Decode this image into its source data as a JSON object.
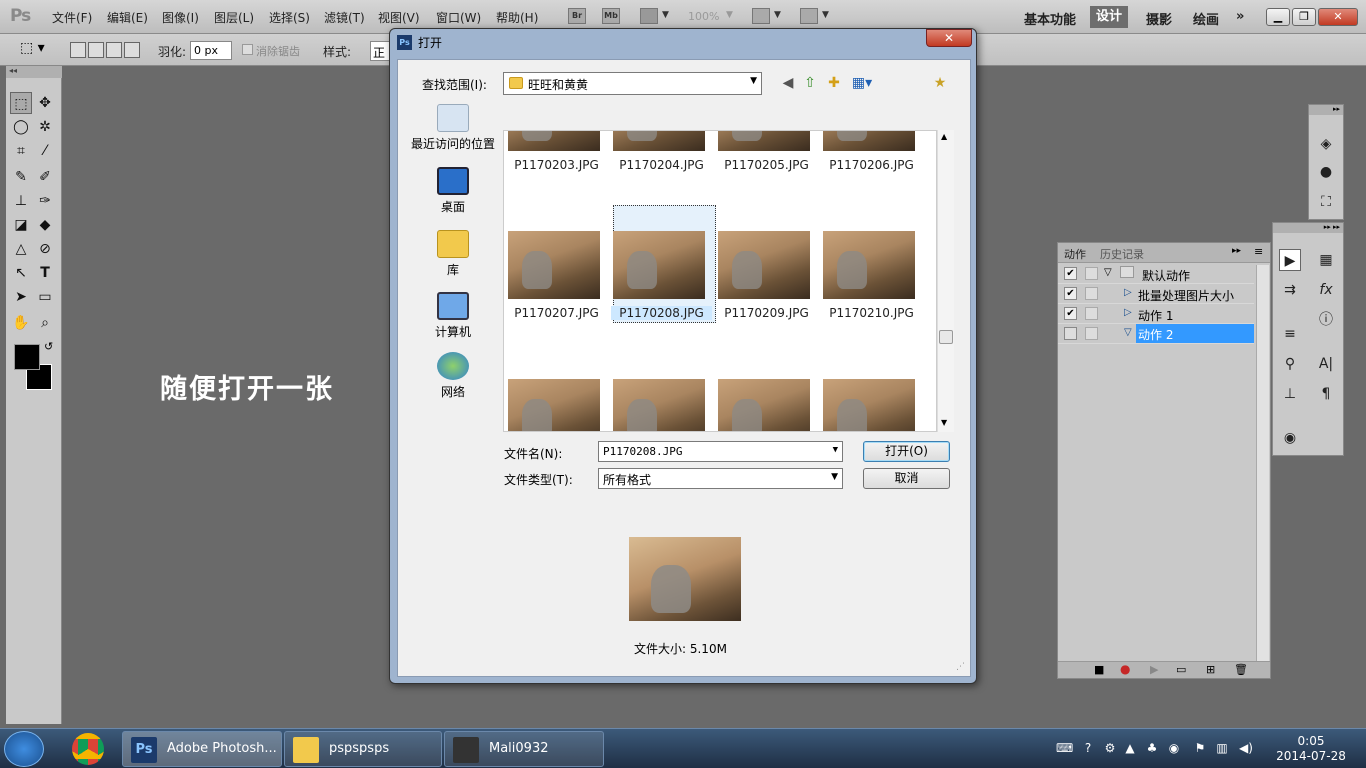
{
  "app": {
    "logo": "Ps"
  },
  "menu": [
    "文件(F)",
    "编辑(E)",
    "图像(I)",
    "图层(L)",
    "选择(S)",
    "滤镜(T)",
    "视图(V)",
    "窗口(W)",
    "帮助(H)"
  ],
  "toolbar_icons": {
    "bridge": "Br",
    "minibridge": "Mb"
  },
  "zoom": "100%",
  "workspaces": {
    "basic": "基本功能",
    "design": "设计",
    "photo": "摄影",
    "paint": "绘画",
    "more": "»"
  },
  "options": {
    "feather_label": "羽化:",
    "feather_value": "0 px",
    "antialias": "消除锯齿",
    "style_label": "样式:",
    "style_value": "正"
  },
  "overlay_text": "随便打开一张",
  "dialog": {
    "title": "打开",
    "lookin_label": "查找范围(I):",
    "lookin_value": "旺旺和黄黄",
    "places": [
      "最近访问的位置",
      "桌面",
      "库",
      "计算机",
      "网络"
    ],
    "files_row1": [
      "P1170203.JPG",
      "P1170204.JPG",
      "P1170205.JPG",
      "P1170206.JPG"
    ],
    "files_row2": [
      "P1170207.JPG",
      "P1170208.JPG",
      "P1170209.JPG",
      "P1170210.JPG"
    ],
    "selected_file": "P1170208.JPG",
    "filename_label": "文件名(N):",
    "filename_value": "P1170208.JPG",
    "filetype_label": "文件类型(T):",
    "filetype_value": "所有格式",
    "open_button": "打开(O)",
    "cancel_button": "取消",
    "filesize": "文件大小: 5.10M"
  },
  "actions_panel": {
    "tabs": [
      "动作",
      "历史记录"
    ],
    "rows": [
      {
        "name": "默认动作",
        "checked": true
      },
      {
        "name": "批量处理图片大小",
        "checked": true
      },
      {
        "name": "动作 1",
        "checked": true
      },
      {
        "name": "动作 2",
        "checked": false
      }
    ]
  },
  "taskbar": {
    "tasks": [
      "Adobe Photosh...",
      "pspspsps",
      "Mali0932"
    ],
    "time": "0:05",
    "date": "2014-07-28"
  },
  "colors": {
    "accent": "#3399ff",
    "selection": "#e5f1fb",
    "taskbar": "#1f2f45"
  }
}
